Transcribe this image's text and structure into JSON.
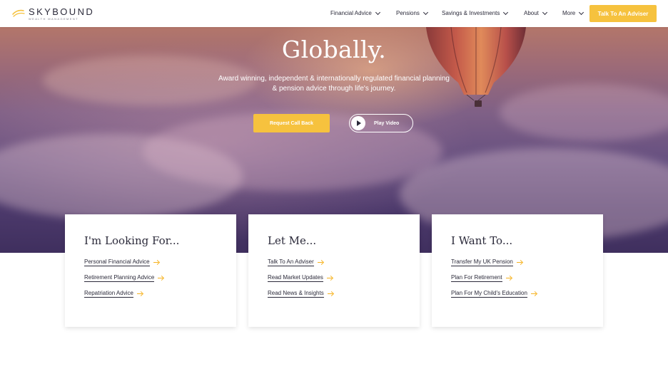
{
  "brand": {
    "name": "SKYBOUND",
    "tagline": "WEALTH MANAGEMENT",
    "accent": "#f6c23e",
    "hero_bottom": "#3f2f5e"
  },
  "nav": {
    "items": [
      {
        "label": "Financial Advice"
      },
      {
        "label": "Pensions"
      },
      {
        "label": "Savings & Investments"
      },
      {
        "label": "About"
      },
      {
        "label": "More"
      }
    ],
    "cta_label": "Talk To An Adviser"
  },
  "hero": {
    "title": "Globally.",
    "subtitle_line1": "Award winning, independent & internationally regulated financial planning",
    "subtitle_line2": "& pension advice through life's journey.",
    "callback_label": "Request Call Back",
    "video_label": "Play Video"
  },
  "cards": [
    {
      "title": "I'm Looking For...",
      "links": [
        "Personal Financial Advice",
        "Retirement Planning Advice",
        "Repatriation Advice"
      ]
    },
    {
      "title": "Let Me...",
      "links": [
        "Talk To An Adviser",
        "Read Market Updates",
        "Read News & Insights"
      ]
    },
    {
      "title": "I Want To...",
      "links": [
        "Transfer My UK Pension",
        "Plan For Retirement",
        "Plan For My Child's Education"
      ]
    }
  ]
}
